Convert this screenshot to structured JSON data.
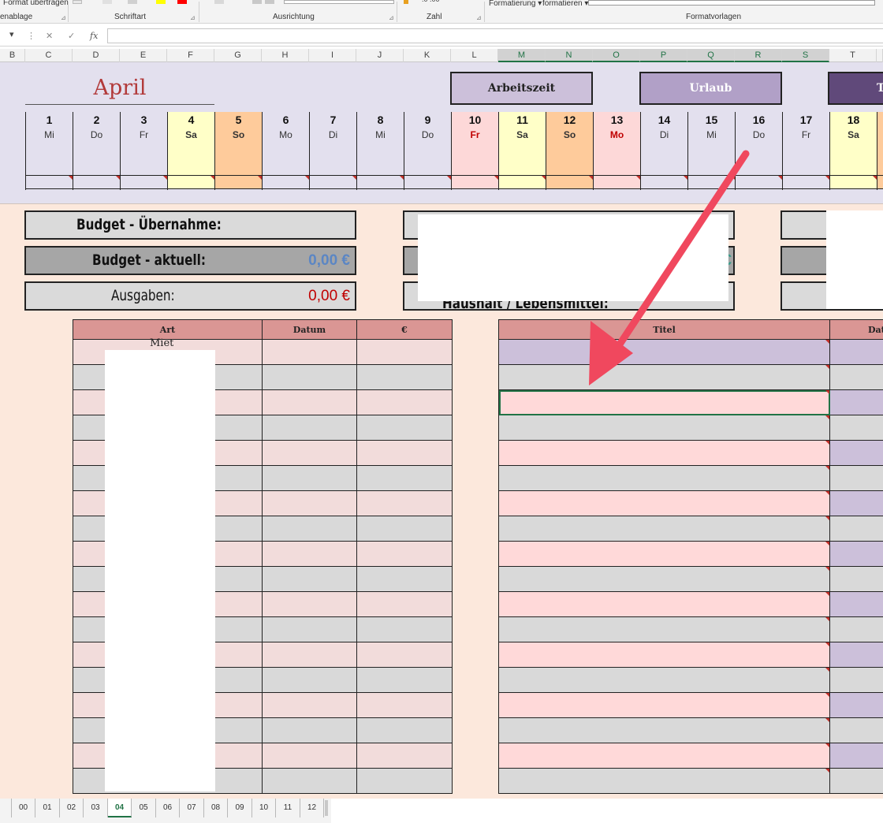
{
  "ribbon": {
    "format_painter": "Format übertragen",
    "conditional_formatting": "Formatierung ▾",
    "format_as_table": "formatieren ▾",
    "groups": [
      "enablage",
      "Schriftart",
      "Ausrichtung",
      "Zahl",
      "Formatvorlagen"
    ]
  },
  "formula_bar": {
    "name_box_arrow": "▾",
    "cancel": "✕",
    "confirm": "✓",
    "fx": "fx",
    "value": ""
  },
  "columns": [
    "B",
    "C",
    "D",
    "E",
    "F",
    "G",
    "H",
    "I",
    "J",
    "K",
    "L",
    "M",
    "N",
    "O",
    "P",
    "Q",
    "R",
    "S",
    "T",
    "U"
  ],
  "calendar": {
    "month": "April",
    "legend": [
      "Arbeitszeit",
      "Urlaub",
      "T"
    ],
    "days": [
      {
        "num": "1",
        "name": "Mi",
        "type": "normal"
      },
      {
        "num": "2",
        "name": "Do",
        "type": "normal"
      },
      {
        "num": "3",
        "name": "Fr",
        "type": "normal"
      },
      {
        "num": "4",
        "name": "Sa",
        "type": "sat"
      },
      {
        "num": "5",
        "name": "So",
        "type": "sun"
      },
      {
        "num": "6",
        "name": "Mo",
        "type": "normal"
      },
      {
        "num": "7",
        "name": "Di",
        "type": "normal"
      },
      {
        "num": "8",
        "name": "Mi",
        "type": "normal"
      },
      {
        "num": "9",
        "name": "Do",
        "type": "normal"
      },
      {
        "num": "10",
        "name": "Fr",
        "type": "hol"
      },
      {
        "num": "11",
        "name": "Sa",
        "type": "sat"
      },
      {
        "num": "12",
        "name": "So",
        "type": "sun"
      },
      {
        "num": "13",
        "name": "Mo",
        "type": "hol"
      },
      {
        "num": "14",
        "name": "Di",
        "type": "normal"
      },
      {
        "num": "15",
        "name": "Mi",
        "type": "normal"
      },
      {
        "num": "16",
        "name": "Do",
        "type": "normal"
      },
      {
        "num": "17",
        "name": "Fr",
        "type": "normal"
      },
      {
        "num": "18",
        "name": "Sa",
        "type": "sat"
      },
      {
        "num": "",
        "name": "",
        "type": "sun"
      }
    ]
  },
  "budget": {
    "transfer_label": "Budget - Übernahme:",
    "current_label": "Budget - aktuell:",
    "current_value": "0,00 €",
    "expenses_label": "Ausgaben:",
    "expenses_value": "0,00 €",
    "mid_partial_text": "Haushalt / Lebensmittel:",
    "colors": {
      "current_value": "#5b86c4",
      "expenses_value": "#c00000"
    }
  },
  "expense_table": {
    "headers": [
      "Art",
      "Datum",
      "€"
    ],
    "first_row_art_partial": "Miet",
    "row_count": 18
  },
  "title_table": {
    "headers": [
      "Titel",
      "Datu"
    ],
    "row_count": 18
  },
  "sheet_tabs": [
    "00",
    "01",
    "02",
    "03",
    "04",
    "05",
    "06",
    "07",
    "08",
    "09",
    "10",
    "11",
    "12"
  ],
  "active_tab": "04"
}
